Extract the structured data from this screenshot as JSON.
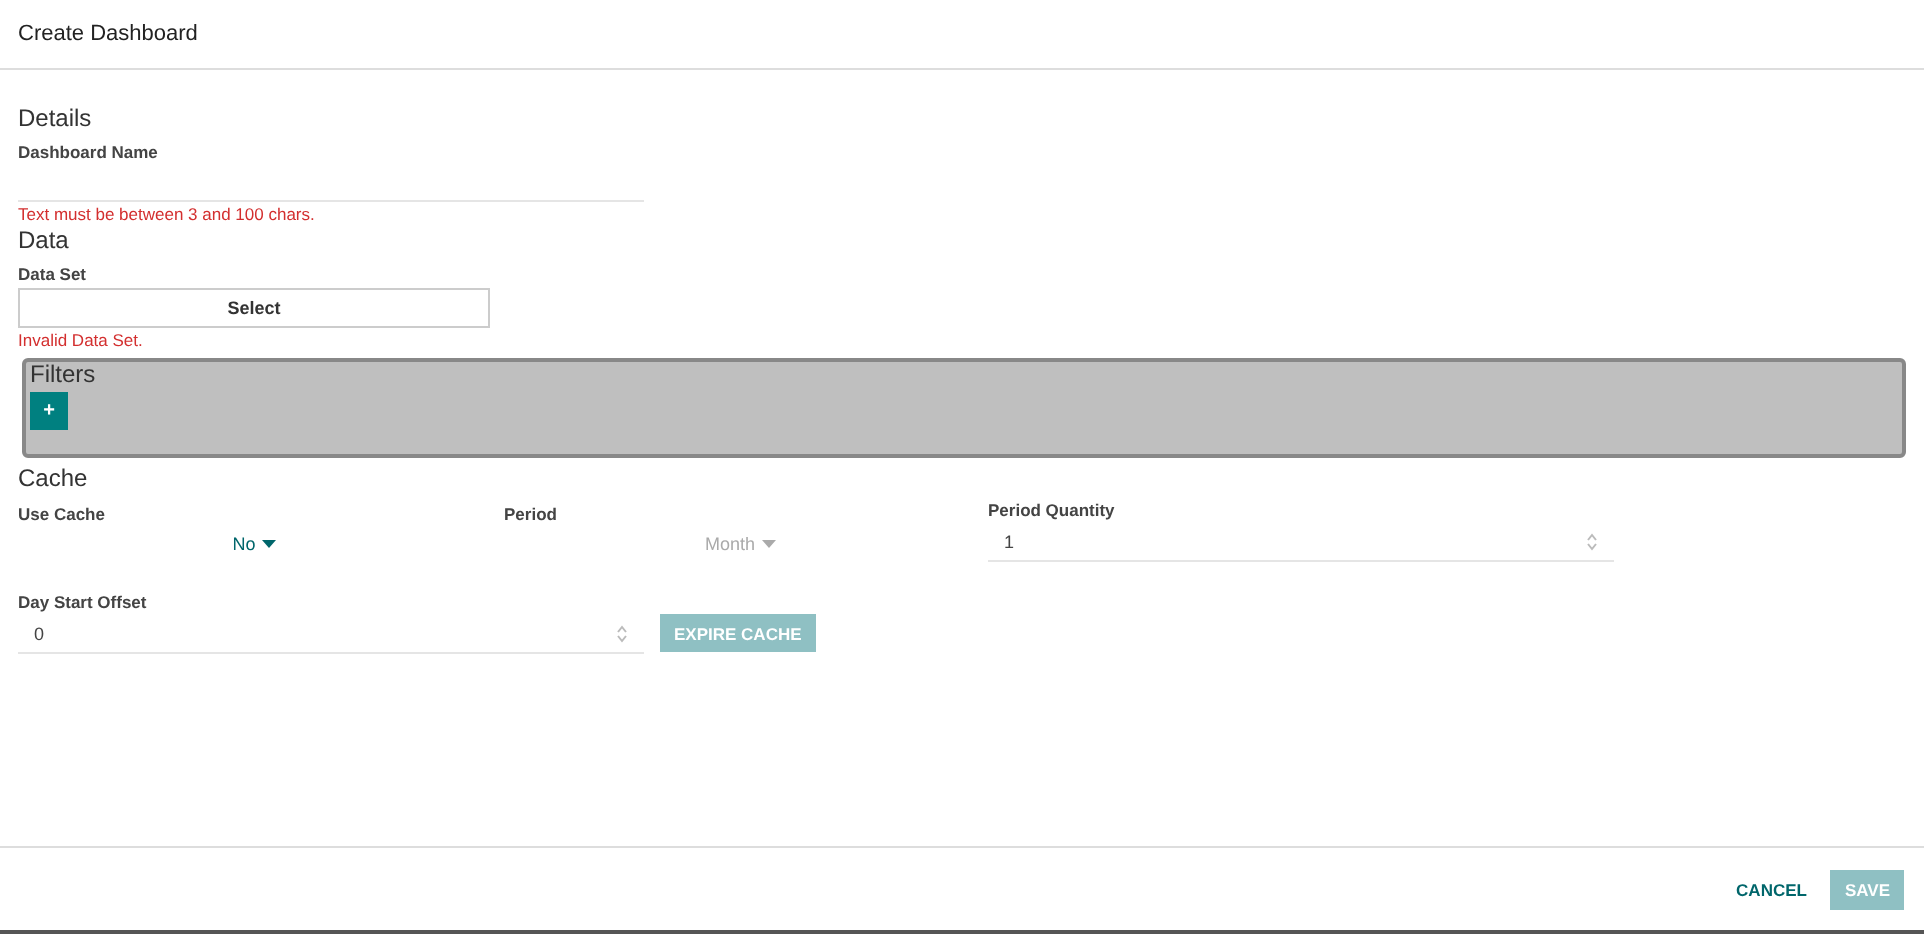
{
  "window": {
    "title": "Create Dashboard"
  },
  "details": {
    "heading": "Details",
    "name_field": {
      "label": "Dashboard Name",
      "error": "Text must be between 3 and 100 chars."
    }
  },
  "data": {
    "heading": "Data",
    "data_set": {
      "label": "Data Set",
      "button": "Select",
      "error": "Invalid Data Set."
    }
  },
  "filters": {
    "heading": "Filters",
    "add_button": "+"
  },
  "cache": {
    "heading": "Cache",
    "use_cache": {
      "label": "Use Cache",
      "value": "No",
      "disabled": false
    },
    "period": {
      "label": "Period",
      "value": "Month",
      "disabled": true
    },
    "period_quantity": {
      "label": "Period Quantity",
      "value": "1"
    },
    "day_start_offset": {
      "label": "Day Start Offset",
      "value": "0"
    },
    "expire_button": {
      "label": "EXPIRE CACHE",
      "disabled": true
    }
  },
  "footer": {
    "cancel": "CANCEL",
    "save": {
      "label": "SAVE",
      "disabled": true
    }
  }
}
